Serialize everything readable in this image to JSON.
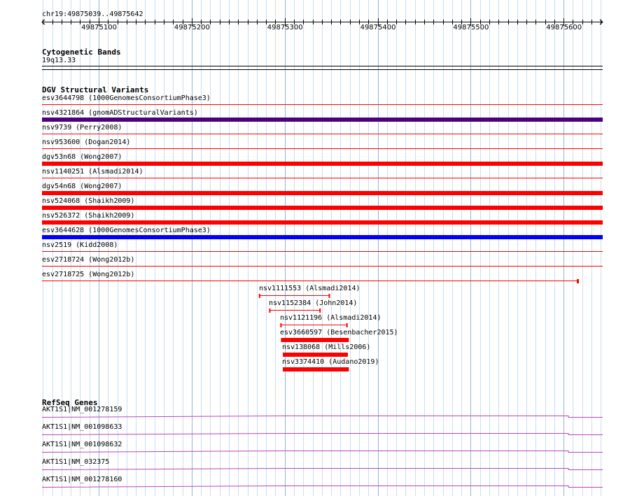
{
  "region": "chr19:49875039..49875642",
  "ruler": {
    "start": 49875039,
    "end": 49875642,
    "ticks": [
      "49875100",
      "49875200",
      "49875300",
      "49875400",
      "49875500",
      "49875600"
    ]
  },
  "tracks": {
    "cytoband": {
      "title": "Cytogenetic Bands",
      "band": "19q13.33"
    },
    "dgv": {
      "title": "DGV Structural Variants",
      "rows": [
        {
          "label": "esv3644798 (1000GenomesConsortiumPhase3)",
          "color": "#ff0000",
          "style": "line"
        },
        {
          "label": "nsv4321864 (gnomADStructuralVariants)",
          "color": "#4b0082",
          "style": "bar"
        },
        {
          "label": "nsv9739 (Perry2008)",
          "color": "#ff0000",
          "style": "line"
        },
        {
          "label": "nsv953600 (Dogan2014)",
          "color": "#ff0000",
          "style": "line"
        },
        {
          "label": "dgv53n68 (Wong2007)",
          "color": "#ff0000",
          "style": "bar"
        },
        {
          "label": "nsv1140251 (Alsmadi2014)",
          "color": "#ff0000",
          "style": "line"
        },
        {
          "label": "dgv54n68 (Wong2007)",
          "color": "#ff0000",
          "style": "bar"
        },
        {
          "label": "nsv524068 (Shaikh2009)",
          "color": "#ff0000",
          "style": "bar"
        },
        {
          "label": "nsv526372 (Shaikh2009)",
          "color": "#ff0000",
          "style": "bar"
        },
        {
          "label": "esv3644628 (1000GenomesConsortiumPhase3)",
          "color": "#0000ff",
          "style": "bar"
        },
        {
          "label": "nsv2519 (Kidd2008)",
          "color": "#ff0000",
          "style": "line"
        },
        {
          "label": "esv2718724 (Wong2012b)",
          "color": "#ff0000",
          "style": "line"
        },
        {
          "label": "esv2718725 (Wong2012b)",
          "color": "#ff0000",
          "style": "line-end"
        }
      ],
      "features": [
        {
          "label": "nsv1111553 (Alsmadi2014)",
          "start": 49875273,
          "end": 49875348,
          "style": "span"
        },
        {
          "label": "nsv1152384 (John2014)",
          "start": 49875284,
          "end": 49875338,
          "style": "span"
        },
        {
          "label": "nsv1121196 (Alsmadi2014)",
          "start": 49875296,
          "end": 49875367,
          "style": "span"
        },
        {
          "label": "esv3660597 (Besenbacher2015)",
          "start": 49875296,
          "end": 49875369,
          "style": "bar"
        },
        {
          "label": "nsv138068 (Mills2006)",
          "start": 49875298,
          "end": 49875368,
          "style": "bar"
        },
        {
          "label": "nsv3374410 (Audano2019)",
          "start": 49875298,
          "end": 49875369,
          "style": "bar"
        }
      ]
    },
    "refseq": {
      "title": "RefSeq Genes",
      "transcripts": [
        {
          "label": "AKT1S1|NM_001278159",
          "color": "#bb44bb"
        },
        {
          "label": "AKT1S1|NM_001098633",
          "color": "#bb44bb"
        },
        {
          "label": "AKT1S1|NM_001098632",
          "color": "#bb44bb"
        },
        {
          "label": "AKT1S1|NM_032375",
          "color": "#bb44bb"
        },
        {
          "label": "AKT1S1|NM_001278160",
          "color": "#bb44bb"
        }
      ]
    }
  }
}
